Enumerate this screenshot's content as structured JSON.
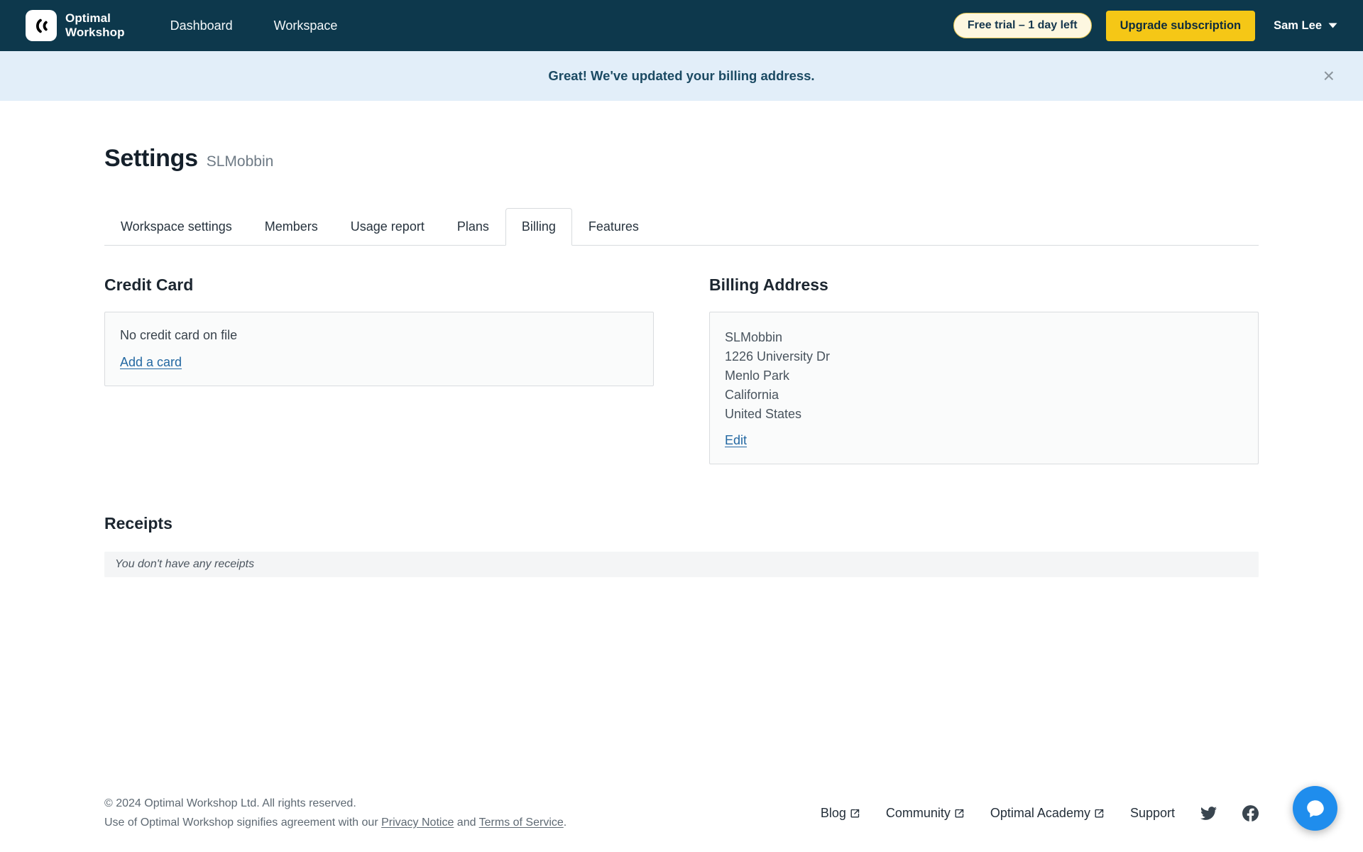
{
  "navbar": {
    "logo_line1": "Optimal",
    "logo_line2": "Workshop",
    "items": [
      {
        "label": "Dashboard"
      },
      {
        "label": "Workspace"
      }
    ],
    "trial_badge": "Free trial – 1 day left",
    "upgrade_button": "Upgrade subscription",
    "user_name": "Sam Lee"
  },
  "banner": {
    "message": "Great! We've updated your billing address.",
    "close_glyph": "×"
  },
  "page": {
    "title": "Settings",
    "subtitle": "SLMobbin"
  },
  "tabs": [
    {
      "label": "Workspace settings",
      "active": false
    },
    {
      "label": "Members",
      "active": false
    },
    {
      "label": "Usage report",
      "active": false
    },
    {
      "label": "Plans",
      "active": false
    },
    {
      "label": "Billing",
      "active": true
    },
    {
      "label": "Features",
      "active": false
    }
  ],
  "credit_card": {
    "heading": "Credit Card",
    "empty_text": "No credit card on file",
    "add_link": "Add a card"
  },
  "billing_address": {
    "heading": "Billing Address",
    "lines": [
      "SLMobbin",
      "1226 University Dr",
      "Menlo Park",
      "California",
      "United States"
    ],
    "edit_link": "Edit"
  },
  "receipts": {
    "heading": "Receipts",
    "empty_text": "You don't have any receipts"
  },
  "footer": {
    "copyright": "© 2024 Optimal Workshop Ltd. All rights reserved.",
    "agreement_prefix": "Use of Optimal Workshop signifies agreement with our ",
    "privacy_link": "Privacy Notice",
    "agreement_middle": " and ",
    "terms_link": "Terms of Service",
    "agreement_suffix": ".",
    "links": [
      {
        "label": "Blog",
        "external": true
      },
      {
        "label": "Community",
        "external": true
      },
      {
        "label": "Optimal Academy",
        "external": true
      },
      {
        "label": "Support",
        "external": false
      }
    ]
  },
  "icons": {
    "close": "close-icon",
    "chevron_down": "chevron-down-icon",
    "external_link": "external-link-icon",
    "twitter": "twitter-icon",
    "facebook": "facebook-icon",
    "chat": "chat-bubble-icon",
    "logo": "optimal-workshop-logo-icon"
  },
  "colors": {
    "navbar_bg": "#0d384c",
    "banner_bg": "#e2eef9",
    "accent_yellow": "#f5c716",
    "trial_pill_bg": "#fdf7e0",
    "trial_pill_border": "#e5c44a",
    "link_blue": "#2368a2",
    "chat_button": "#1f8ded",
    "card_bg": "#fafbfb",
    "card_border": "#d9dcdf"
  }
}
